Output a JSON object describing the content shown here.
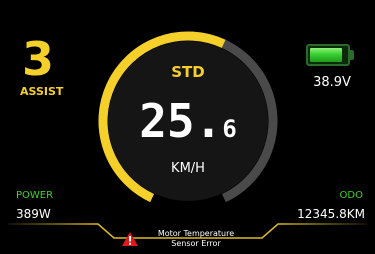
{
  "colors": {
    "accent_yellow": "#f5cf2a",
    "gauge_track": "#4a4a4a",
    "green": "#3fd12a",
    "warning_red": "#e0191c",
    "background": "#000000"
  },
  "assist": {
    "level": "3",
    "label": "ASSIST"
  },
  "battery": {
    "icon": "battery-icon",
    "charge_fraction": 0.9,
    "voltage": "38.9V"
  },
  "speedometer": {
    "mode": "STD",
    "speed_integer": "25.",
    "speed_decimal": "6",
    "unit": "KM/H",
    "arc_fill_fraction": 0.58
  },
  "power": {
    "label": "POWER",
    "value": "389W"
  },
  "odometer": {
    "label": "ODO",
    "value": "12345.8KM"
  },
  "alert": {
    "icon": "warning-triangle-icon",
    "message_line1": "Motor Temperature",
    "message_line2": "Sensor Error"
  }
}
